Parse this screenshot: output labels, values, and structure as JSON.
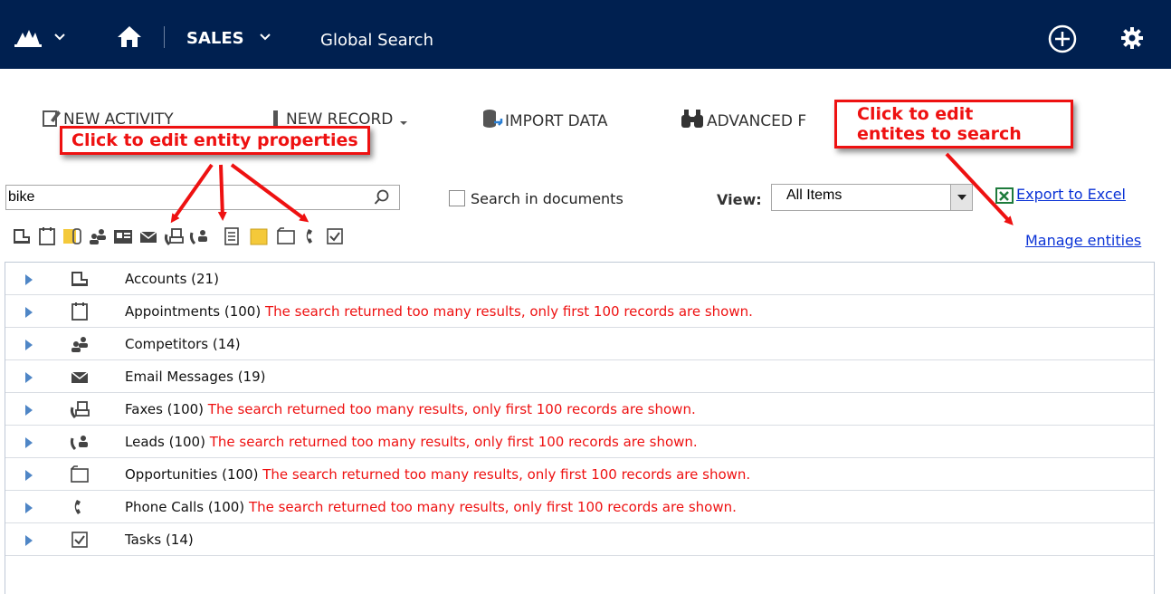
{
  "topbar": {
    "module": "SALES",
    "page_title": "Global Search"
  },
  "ribbon": {
    "new_activity": "NEW ACTIVITY",
    "new_record": "NEW RECORD",
    "import_data": "IMPORT DATA",
    "advanced_find": "ADVANCED F"
  },
  "search": {
    "value": "bike",
    "search_in_documents": "Search in documents",
    "view_label": "View:",
    "view_value": "All Items",
    "export_excel": "Export to Excel",
    "manage_entities": "Manage entities"
  },
  "entity_icons": [
    "account-icon",
    "appointment-icon",
    "attachment-note-icon",
    "competitor-icon",
    "contact-card-icon",
    "email-icon",
    "fax-icon",
    "lead-icon",
    "document-icon",
    "note-icon",
    "opportunity-icon",
    "phone-icon",
    "task-icon"
  ],
  "results": [
    {
      "label": "Accounts (21)",
      "warning": "",
      "icon": "account-icon"
    },
    {
      "label": "Appointments (100)",
      "warning": "The search returned too many results, only first 100 records are shown.",
      "icon": "appointment-icon"
    },
    {
      "label": "Competitors (14)",
      "warning": "",
      "icon": "competitor-icon"
    },
    {
      "label": "Email Messages (19)",
      "warning": "",
      "icon": "email-icon"
    },
    {
      "label": "Faxes (100)",
      "warning": "The search returned too many results, only first 100 records are shown.",
      "icon": "fax-icon"
    },
    {
      "label": "Leads (100)",
      "warning": "The search returned too many results, only first 100 records are shown.",
      "icon": "lead-icon"
    },
    {
      "label": "Opportunities (100)",
      "warning": "The search returned too many results, only first 100 records are shown.",
      "icon": "opportunity-icon"
    },
    {
      "label": "Phone Calls (100)",
      "warning": "The search returned too many results, only first 100 records are shown.",
      "icon": "phone-icon"
    },
    {
      "label": "Tasks (14)",
      "warning": "",
      "icon": "task-icon"
    }
  ],
  "callouts": {
    "entity_properties": "Click to edit entity properties",
    "entities_to_search_line1": "Click to edit",
    "entities_to_search_line2": "entites to search"
  },
  "colors": {
    "nav_bg": "#002050",
    "warning": "#ee1111",
    "link": "#0b33d6",
    "callout": "#ee1111",
    "expander": "#4f86c6"
  }
}
